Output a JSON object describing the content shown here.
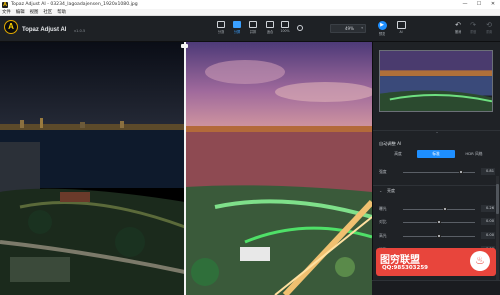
{
  "window": {
    "title": "Topaz Adjust AI - 03234_lagoadajensen_1920x1080.jpg",
    "app_icon": "topaz-icon",
    "controls": [
      "—",
      "☐",
      "✕"
    ]
  },
  "menu": [
    "文件",
    "编辑",
    "视图",
    "社区",
    "帮助"
  ],
  "header": {
    "brand": "Topaz Adjust AI",
    "version": "v1.0.5",
    "logo_letter": "A",
    "view_buttons": [
      {
        "label": "分割",
        "icon": "single-view-icon"
      },
      {
        "label": "分屏",
        "icon": "split-view-icon",
        "active": true
      },
      {
        "label": "并排",
        "icon": "side-by-side-icon"
      },
      {
        "label": "适合",
        "icon": "fit-icon"
      },
      {
        "label": "100%",
        "icon": "zoom-100-icon"
      }
    ],
    "zoom_value": "49%",
    "preview_label": "预览",
    "preview_icon": "preview-icon",
    "ai_label": "AI",
    "undo_label": "撤消",
    "redo_label": "重做",
    "reset_label": "重置",
    "close_label": "关闭"
  },
  "panel": {
    "auto_adjust_title": "自动调整 AI",
    "modes": [
      "高度",
      "标准",
      "HDR 风格"
    ],
    "selected_mode": "标准",
    "strength": {
      "label": "强度",
      "value": "0.81",
      "level": 0.81
    },
    "section": {
      "title": "亮度",
      "expanded": true
    },
    "sliders": [
      {
        "label": "曝光",
        "value": "0.26",
        "level": 0.58
      },
      {
        "label": "对比",
        "value": "0.00",
        "level": 0.5
      },
      {
        "label": "高光",
        "value": "0.00",
        "level": 0.5
      },
      {
        "label": "阴影",
        "value": "0.00",
        "level": 0.5
      }
    ],
    "collapse_icon": "chevron-up-icon"
  },
  "watermark": {
    "name": "图穷联盟",
    "qq": "QQ:985303259"
  },
  "colors": {
    "accent": "#1e8fff",
    "logo": "#ffd400",
    "panel_bg": "#1f2226",
    "header_bg": "#1e2125",
    "watermark": "#e8453c"
  }
}
